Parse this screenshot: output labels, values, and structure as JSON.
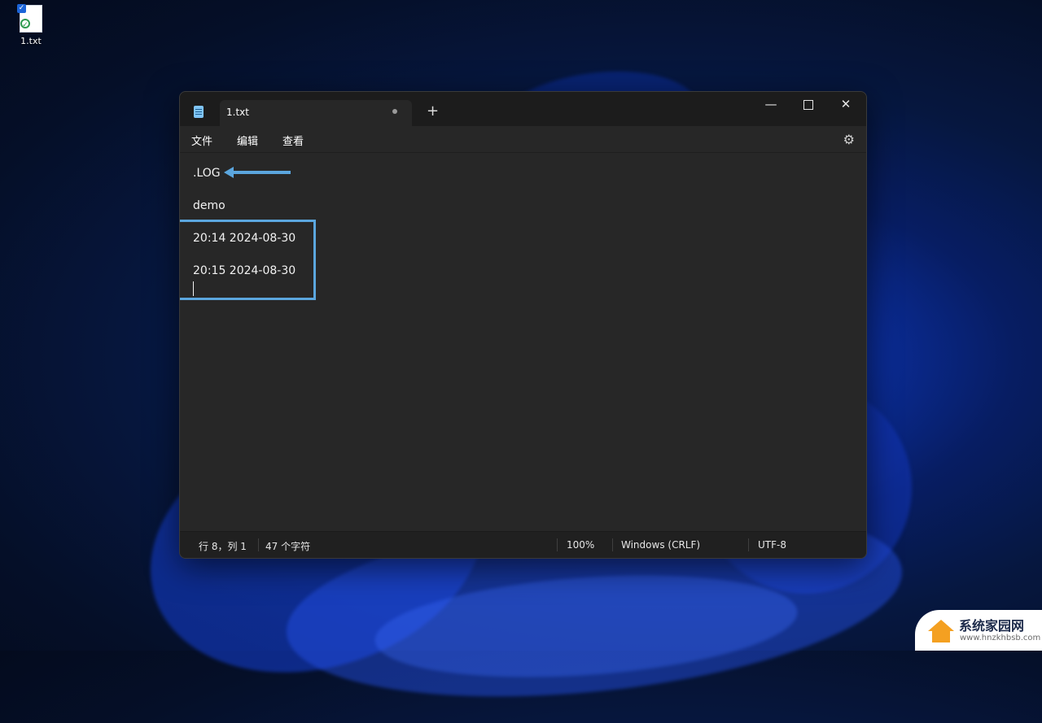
{
  "desktop": {
    "icon_label": "1.txt"
  },
  "window": {
    "tab_title": "1.txt",
    "new_tab_symbol": "+",
    "controls": {
      "minimize": "—",
      "close": "✕"
    }
  },
  "menu": {
    "file": "文件",
    "edit": "编辑",
    "view": "查看",
    "settings_icon": "⚙"
  },
  "editor": {
    "lines": [
      ".LOG",
      "demo",
      "20:14 2024-08-30",
      "20:15 2024-08-30"
    ]
  },
  "statusbar": {
    "position": "行 8，列 1",
    "char_count": "47 个字符",
    "zoom": "100%",
    "line_ending": "Windows (CRLF)",
    "encoding": "UTF-8"
  },
  "watermark": {
    "title": "系统家园网",
    "url": "www.hnzkhbsb.com"
  },
  "colors": {
    "accent_annotation": "#5ba6de",
    "editor_bg": "#272727",
    "titlebar_bg": "#1c1c1c"
  }
}
